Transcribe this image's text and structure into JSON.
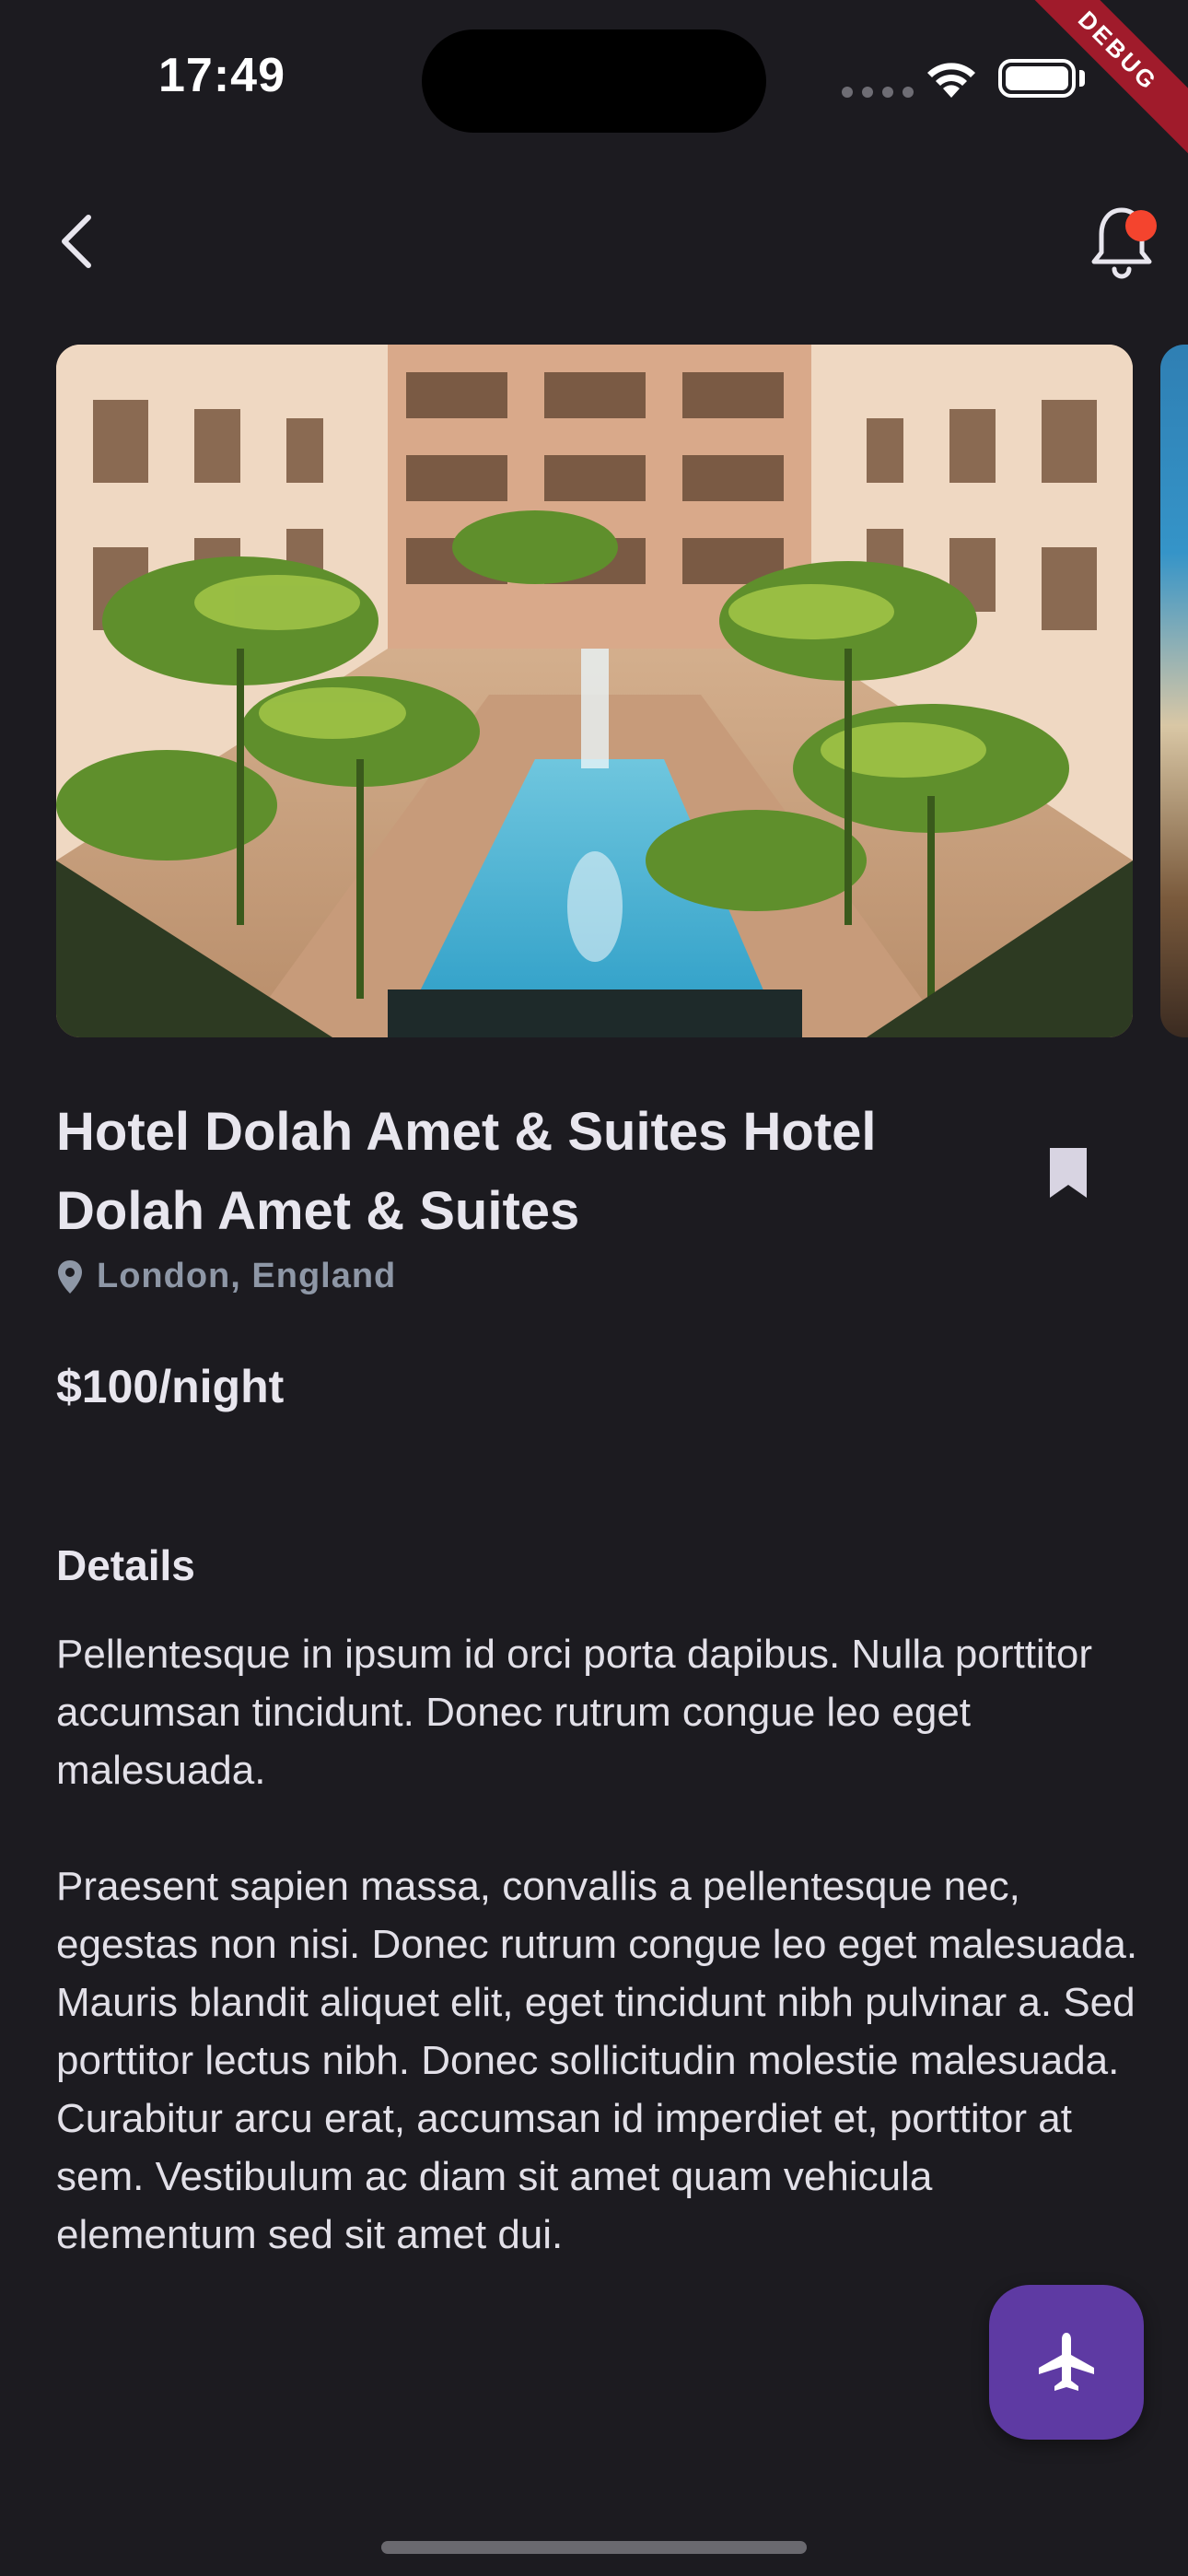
{
  "status_bar": {
    "time": "17:49",
    "debug_label": "DEBUG"
  },
  "header": {
    "back_icon": "chevron-left-icon",
    "notification_icon": "bell-icon",
    "notification_badge_color": "#f4442e"
  },
  "hotel": {
    "image_icon": "hotel-courtyard-pool-photo",
    "title": "Hotel Dolah Amet & Suites Hotel Dolah Amet & Suites",
    "bookmark_icon": "bookmark-icon",
    "location_icon": "map-pin-icon",
    "location": "London, England",
    "price": "$100/night"
  },
  "details": {
    "heading": "Details",
    "body": "Pellentesque in ipsum id orci porta dapibus. Nulla porttitor accumsan tincidunt. Donec rutrum congue leo eget malesuada.\n\nPraesent sapien massa, convallis a pellentesque nec, egestas non nisi. Donec rutrum congue leo eget malesuada. Mauris blandit aliquet elit, eget tincidunt nibh pulvinar a. Sed porttitor lectus nibh. Donec sollicitudin molestie malesuada.\nCurabitur arcu erat, accumsan id imperdiet et, porttitor at sem. Vestibulum ac diam sit amet quam vehicula elementum sed sit amet dui."
  },
  "fab": {
    "icon": "airplane-icon",
    "color": "#5e3aa3"
  },
  "theme": {
    "background": "#1c1b20",
    "muted_text": "#8e97a6"
  }
}
